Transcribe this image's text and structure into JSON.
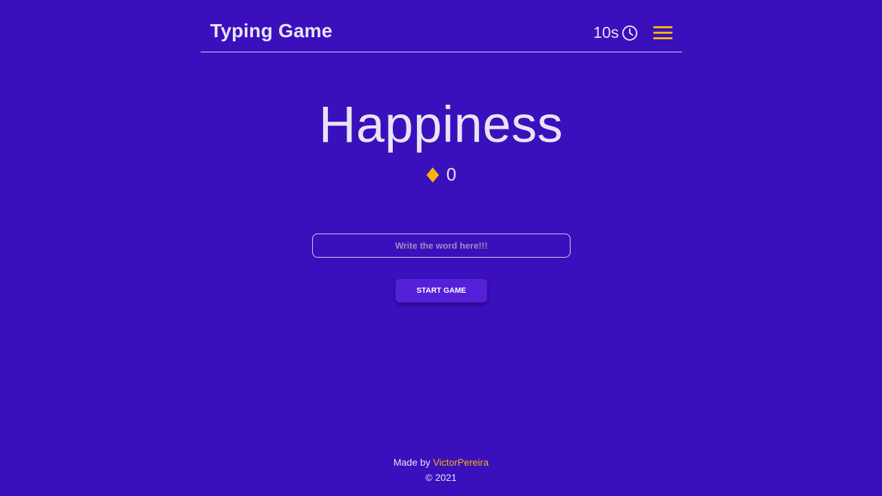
{
  "header": {
    "title": "Typing Game",
    "timer": "10s"
  },
  "game": {
    "word": "Happiness",
    "score": "0"
  },
  "input": {
    "placeholder": "Write the word here!!!",
    "value": ""
  },
  "start_button": {
    "label": "START GAME"
  },
  "footer": {
    "made_by": "Made by",
    "author": "VictorPereira",
    "copyright": "© 2021"
  },
  "colors": {
    "background": "#3a10bd",
    "accent": "#f2b705",
    "text": "#e8e4f6",
    "button": "#5420d8"
  },
  "icons": {
    "clock": "clock-icon",
    "menu": "hamburger-menu-icon",
    "score": "diamond-icon"
  }
}
